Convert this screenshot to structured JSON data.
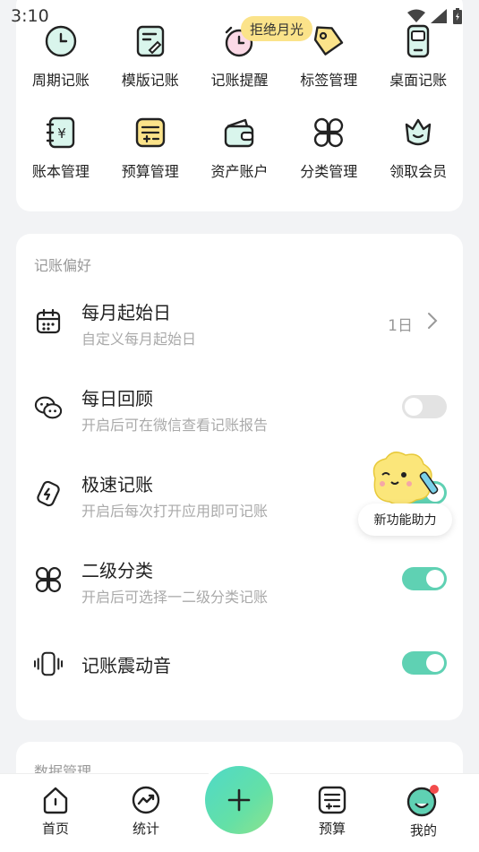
{
  "status_bar": {
    "time": "3:10"
  },
  "float_tag": "拒绝月光",
  "quick_grid": [
    {
      "label": "周期记账",
      "icon": "clock-icon"
    },
    {
      "label": "模版记账",
      "icon": "template-icon"
    },
    {
      "label": "记账提醒",
      "icon": "alarm-icon"
    },
    {
      "label": "标签管理",
      "icon": "tag-icon"
    },
    {
      "label": "桌面记账",
      "icon": "widget-icon"
    },
    {
      "label": "账本管理",
      "icon": "ledger-icon"
    },
    {
      "label": "预算管理",
      "icon": "budget-icon"
    },
    {
      "label": "资产账户",
      "icon": "wallet-icon"
    },
    {
      "label": "分类管理",
      "icon": "category-icon"
    },
    {
      "label": "领取会员",
      "icon": "vip-icon"
    }
  ],
  "preferences": {
    "title": "记账偏好",
    "rows": [
      {
        "title": "每月起始日",
        "subtitle": "自定义每月起始日",
        "value": "1日",
        "icon": "calendar-icon"
      },
      {
        "title": "每日回顾",
        "subtitle": "开启后可在微信查看记账报告",
        "toggle": "off",
        "icon": "wechat-icon"
      },
      {
        "title": "极速记账",
        "subtitle": "开启后每次打开应用即可记账",
        "toggle": "on",
        "icon": "lightning-icon"
      },
      {
        "title": "二级分类",
        "subtitle": "开启后可选择一二级分类记账",
        "toggle": "on",
        "icon": "category-icon"
      },
      {
        "title": "记账震动音",
        "subtitle": "",
        "toggle": "on",
        "icon": "vibrate-icon"
      }
    ]
  },
  "helper_label": "新功能助力",
  "data_section": {
    "title": "数据管理"
  },
  "bottom_nav": [
    {
      "label": "首页",
      "icon": "home-icon"
    },
    {
      "label": "统计",
      "icon": "stats-icon"
    },
    {
      "label": "预算",
      "icon": "budget-icon"
    },
    {
      "label": "我的",
      "icon": "profile-icon"
    }
  ],
  "colors": {
    "accent": "#5fd1b3",
    "tag": "#fbe38a",
    "notification_dot": "#f24c4c"
  }
}
